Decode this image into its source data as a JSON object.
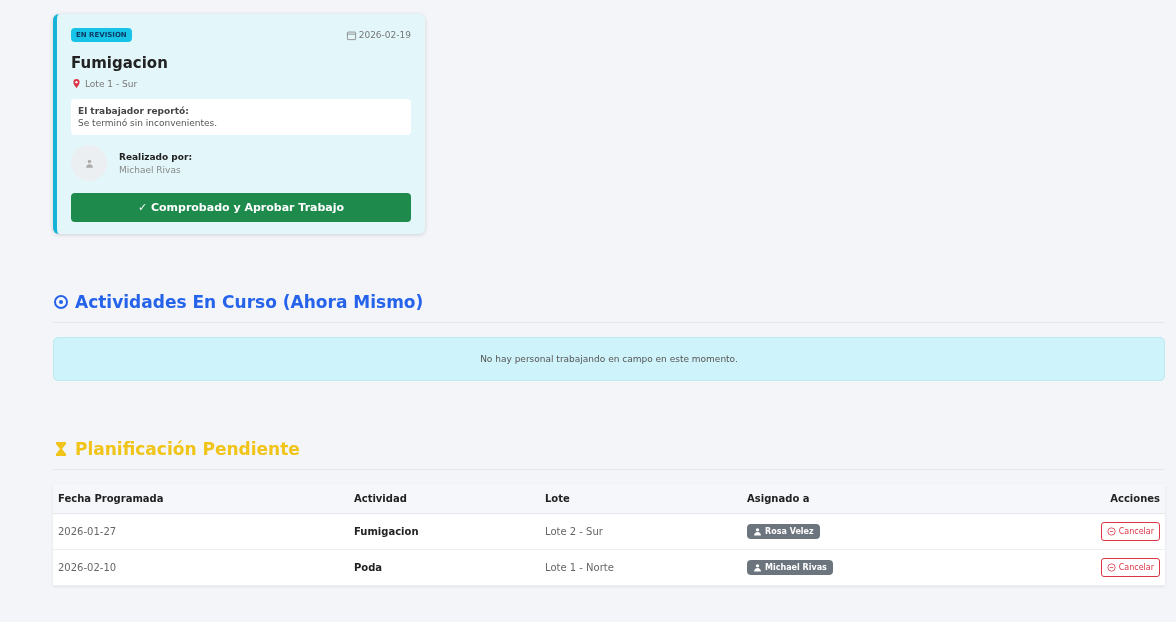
{
  "review_card": {
    "status": "EN REVISION",
    "date": "2026-02-19",
    "title": "Fumigacion",
    "location": "Lote 1 - Sur",
    "report_label": "El trabajador reportó:",
    "report_text": "Se terminó sin inconvenientes.",
    "done_by_label": "Realizado por:",
    "done_by": "Michael Rivas",
    "approve_button": "✓ Comprobado y Aprobar Trabajo"
  },
  "in_progress": {
    "title": "Actividades En Curso (Ahora Mismo)",
    "message": "No hay personal trabajando en campo en este momento."
  },
  "pending": {
    "title": "Planificación Pendiente",
    "columns": [
      "Fecha Programada",
      "Actividad",
      "Lote",
      "Asignado a",
      "Acciones"
    ],
    "rows": [
      {
        "date": "2026-01-27",
        "activity": "Fumigacion",
        "lot": "Lote 2 - Sur",
        "assignee": "Rosa Velez",
        "action": "Cancelar"
      },
      {
        "date": "2026-02-10",
        "activity": "Poda",
        "lot": "Lote 1 - Norte",
        "assignee": "Michael Rivas",
        "action": "Cancelar"
      }
    ]
  }
}
